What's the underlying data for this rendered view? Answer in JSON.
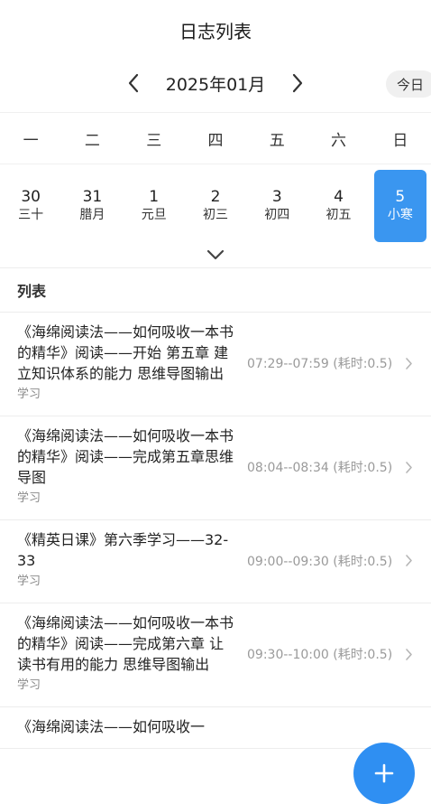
{
  "header": {
    "title": "日志列表"
  },
  "month_bar": {
    "month": "2025年01月",
    "today_label": "今日"
  },
  "weekdays": [
    "一",
    "二",
    "三",
    "四",
    "五",
    "六",
    "日"
  ],
  "days": [
    {
      "num": "30",
      "lunar": "三十"
    },
    {
      "num": "31",
      "lunar": "腊月"
    },
    {
      "num": "1",
      "lunar": "元旦"
    },
    {
      "num": "2",
      "lunar": "初三"
    },
    {
      "num": "3",
      "lunar": "初四"
    },
    {
      "num": "4",
      "lunar": "初五"
    },
    {
      "num": "5",
      "lunar": "小寒"
    }
  ],
  "selected_day_index": 6,
  "list": {
    "title": "列表",
    "items": [
      {
        "name": "《海绵阅读法——如何吸收一本书的精华》阅读——开始 第五章 建立知识体系的能力 思维导图输出",
        "tag": "学习",
        "time": "07:29--07:59 (耗时:0.5)"
      },
      {
        "name": "《海绵阅读法——如何吸收一本书的精华》阅读——完成第五章思维导图",
        "tag": "学习",
        "time": "08:04--08:34 (耗时:0.5)"
      },
      {
        "name": "《精英日课》第六季学习——32-33",
        "tag": "学习",
        "time": "09:00--09:30 (耗时:0.5)"
      },
      {
        "name": "《海绵阅读法——如何吸收一本书的精华》阅读——完成第六章 让读书有用的能力 思维导图输出",
        "tag": "学习",
        "time": "09:30--10:00 (耗时:0.5)"
      },
      {
        "name": "《海绵阅读法——如何吸收一",
        "tag": "",
        "time": ""
      }
    ]
  },
  "colors": {
    "accent": "#3a96f0",
    "fab": "#2f8ff2"
  },
  "icons": [
    "chevron-left-icon",
    "chevron-right-icon",
    "chevron-down-icon",
    "plus-icon"
  ]
}
